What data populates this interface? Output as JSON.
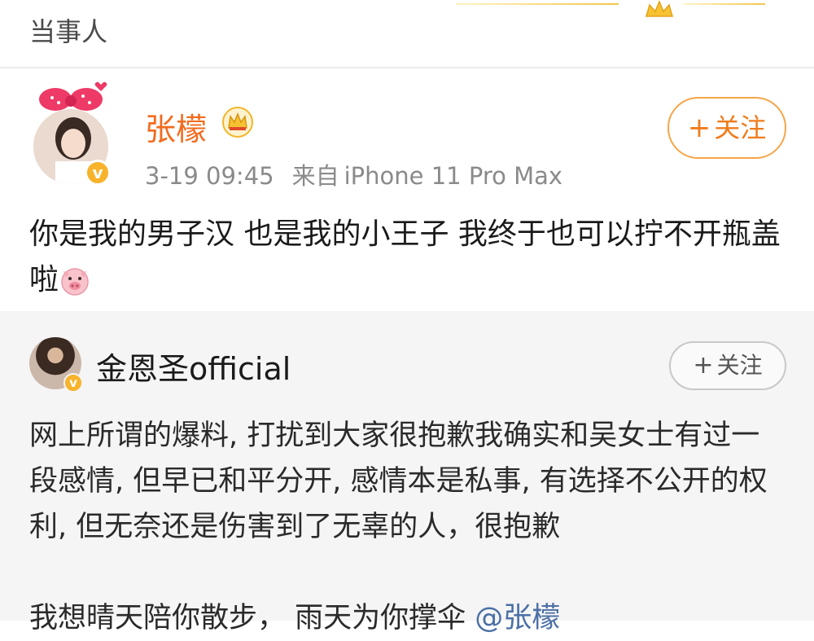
{
  "header": {
    "title": "当事人"
  },
  "post": {
    "author": "张檬",
    "date": "3-19 09:45",
    "source_prefix": "来自",
    "device": "iPhone 11 Pro Max",
    "follow_label": "关注",
    "follow_plus": "+",
    "text": "你是我的男子汉  也是我的小王子  我终于也可以拧不开瓶盖啦",
    "emoji": "pig-face-icon"
  },
  "repost": {
    "author": "金恩圣official",
    "follow_label": "关注",
    "follow_plus": "+",
    "paragraph1": "网上所谓的爆料, 打扰到大家很抱歉我确实和吴女士有过一段感情, 但早已和平分开, 感情本是私事, 有选择不公开的权利, 但无奈还是伤害到了无辜的人，很抱歉",
    "paragraph2_text": "我想晴天陪你散步，  雨天为你撑伞 ",
    "mention": "@张檬"
  },
  "colors": {
    "accent": "#f26b1d",
    "follow_border": "#f5a54a",
    "verified": "#f7b32b",
    "mention": "#4a6fa5",
    "repost_bg": "#f5f5f5"
  }
}
